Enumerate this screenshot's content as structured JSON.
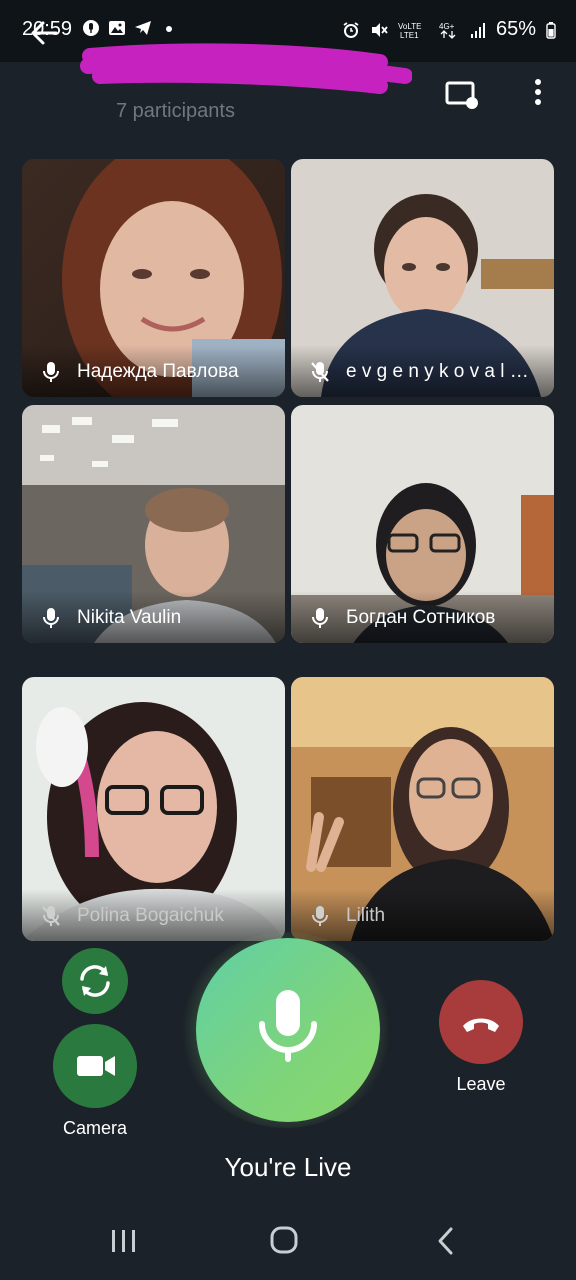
{
  "status": {
    "time": "20:59",
    "battery": "65%",
    "left_icons": [
      "voice-icon",
      "image-icon",
      "telegram-icon",
      "dot-icon"
    ],
    "right_icons": [
      "alarm-icon",
      "mute-icon",
      "volte-icon",
      "signal-4g-icon",
      "signal-bars-icon",
      "battery-icon"
    ]
  },
  "header": {
    "participants": "7 participants"
  },
  "tiles": [
    {
      "name": "Надежда Павлова",
      "mic": "on"
    },
    {
      "name": "e v g e n y k o v a l …",
      "mic": "muted"
    },
    {
      "name": "Nikita Vaulin",
      "mic": "on"
    },
    {
      "name": "Богдан Сотников",
      "mic": "on"
    },
    {
      "name": "Polina Bogaichuk",
      "mic": "muted"
    },
    {
      "name": "Lilith",
      "mic": "on"
    }
  ],
  "controls": {
    "camera_label": "Camera",
    "leave_label": "Leave",
    "live_label": "You're Live"
  },
  "colors": {
    "background": "#1c2229",
    "camera_button": "#2a7a3f",
    "mic_button": "#7ed47a",
    "leave_button": "#a83b3b"
  }
}
